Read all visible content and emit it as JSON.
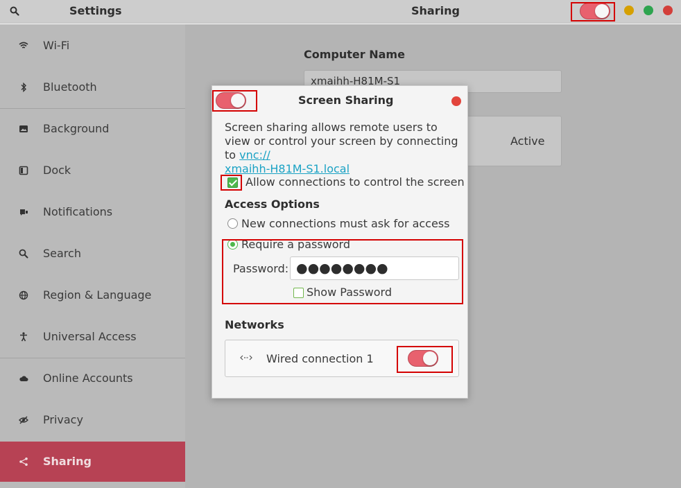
{
  "header": {
    "settings_title": "Settings",
    "page_title": "Sharing",
    "sharing_toggle_on": true,
    "window_buttons": [
      {
        "name": "minimize-button",
        "color": "#d6a000"
      },
      {
        "name": "maximize-button",
        "color": "#2ea44f"
      },
      {
        "name": "close-button",
        "color": "#d33f3a"
      }
    ]
  },
  "sidebar": {
    "items": [
      {
        "label": "Wi-Fi",
        "icon": "wifi-icon"
      },
      {
        "label": "Bluetooth",
        "icon": "bluetooth-icon"
      },
      {
        "label": "Background",
        "icon": "background-icon"
      },
      {
        "label": "Dock",
        "icon": "dock-icon"
      },
      {
        "label": "Notifications",
        "icon": "notifications-icon"
      },
      {
        "label": "Search",
        "icon": "search-icon"
      },
      {
        "label": "Region & Language",
        "icon": "globe-icon"
      },
      {
        "label": "Universal Access",
        "icon": "universal-access-icon"
      },
      {
        "label": "Online Accounts",
        "icon": "cloud-icon"
      },
      {
        "label": "Privacy",
        "icon": "privacy-icon"
      },
      {
        "label": "Sharing",
        "icon": "share-icon",
        "active": true
      }
    ]
  },
  "main": {
    "computer_name_label": "Computer Name",
    "computer_name_value": "xmaihh-H81M-S1",
    "status_text": "Active"
  },
  "dialog": {
    "title": "Screen Sharing",
    "enabled": true,
    "description": "Screen sharing allows remote users to view or control your screen by connecting to ",
    "link_text": "vnc://xmaihh-H81M-S1.local",
    "link_line1": "vnc://",
    "link_line2": "xmaihh-H81M-S1.local",
    "allow_control_label": "Allow connections to control the screen",
    "allow_control_checked": true,
    "access_options_heading": "Access Options",
    "option_ask_label": "New connections must ask for access",
    "option_password_label": "Require a password",
    "selected_option": "password",
    "password_label": "Password:",
    "password_masked": "●●●●●●●●",
    "show_password_label": "Show Password",
    "show_password_checked": false,
    "networks_heading": "Networks",
    "network_name": "Wired connection 1",
    "network_enabled": true
  },
  "colors": {
    "accent_active": "#b74254",
    "toggle_on": "#e8616e",
    "check_green": "#4eb84d",
    "link": "#1aa2c4",
    "highlight_frame": "#d40000"
  }
}
